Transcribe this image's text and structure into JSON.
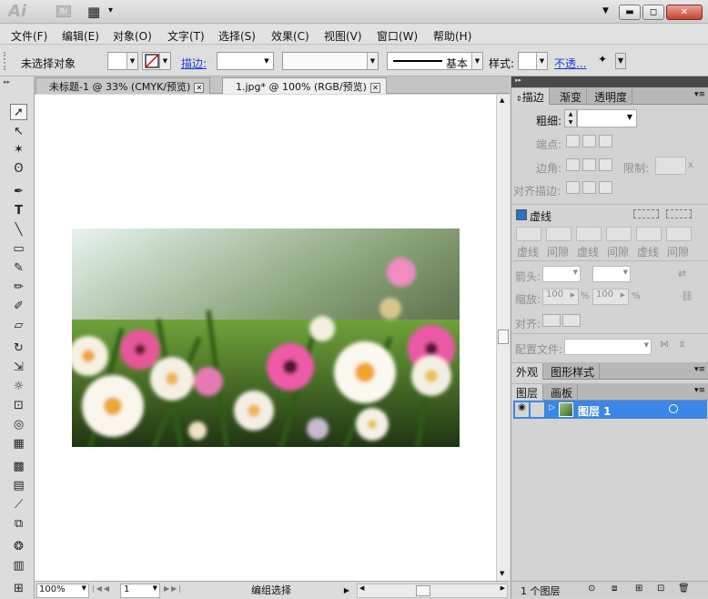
{
  "app": {
    "logo": "Ai",
    "bridge": "Br",
    "arrange_icon": "▦",
    "arrange_caret": "▾"
  },
  "window": {
    "help_caret": "▼",
    "minimize": "▬",
    "restore": "◻",
    "close": "✕"
  },
  "menu": [
    "文件(F)",
    "编辑(E)",
    "对象(O)",
    "文字(T)",
    "选择(S)",
    "效果(C)",
    "视图(V)",
    "窗口(W)",
    "帮助(H)"
  ],
  "control": {
    "no_selection": "未选择对象",
    "stroke_link": "描边:",
    "stroke_profile": "基本",
    "style_label": "样式:",
    "opacity_link": "不透..."
  },
  "doc_tabs": [
    {
      "label": "未标题-1 @ 33% (CMYK/预览)",
      "close": "✕"
    },
    {
      "label": "1.jpg* @ 100% (RGB/预览)",
      "close": "✕"
    }
  ],
  "status": {
    "zoom": "100%",
    "page": "1",
    "mode": "编组选择"
  },
  "panel": {
    "tabs": [
      "描边",
      "渐变",
      "透明度"
    ],
    "weight_label": "粗细:",
    "cap_label": "端点:",
    "corner_label": "边角:",
    "limit_label": "限制:",
    "limit_x": "x",
    "align_label": "对齐描边:",
    "dashed_label": "虚线",
    "dash_labels": [
      "虚线",
      "间隙",
      "虚线",
      "间隙",
      "虚线",
      "间隙"
    ],
    "arrow_label": "箭头:",
    "scale_label": "缩放:",
    "scale1": "100",
    "scale2": "100",
    "pct": "%",
    "align2_label": "对齐:",
    "profile_label": "配置文件:"
  },
  "appearance_tabs": [
    "外观",
    "图形样式"
  ],
  "layers_tabs": [
    "图层",
    "画板"
  ],
  "layer": {
    "name": "图层 1",
    "count": "1 个图层"
  }
}
